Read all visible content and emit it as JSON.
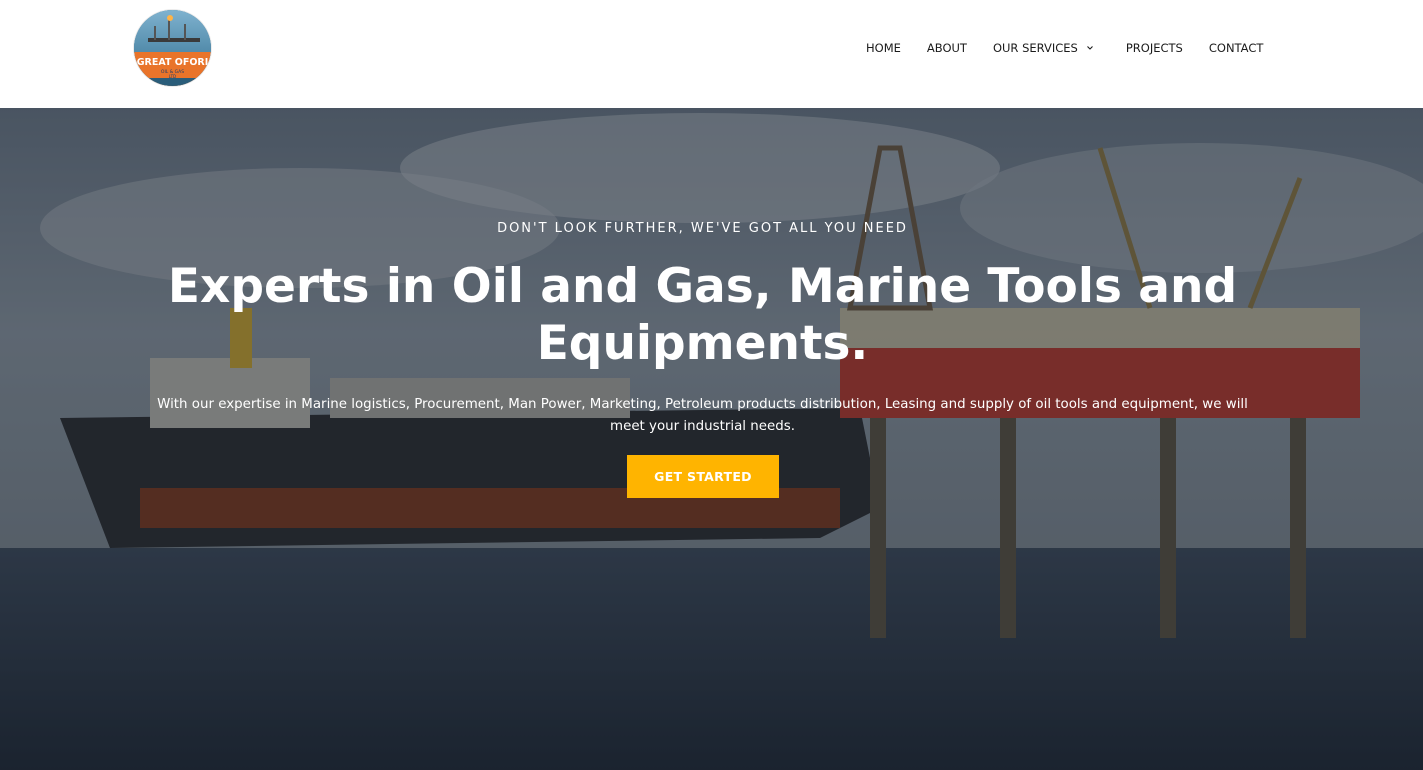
{
  "brand": {
    "logo_lines": [
      "GREAT OFORI",
      "OIL & GAS",
      "LTD"
    ]
  },
  "nav": {
    "items": [
      {
        "label": "HOME"
      },
      {
        "label": "ABOUT"
      },
      {
        "label": "OUR SERVICES",
        "has_dropdown": true
      },
      {
        "label": "PROJECTS"
      },
      {
        "label": "CONTACT"
      }
    ]
  },
  "hero": {
    "eyebrow": "DON'T LOOK FURTHER, WE'VE GOT ALL YOU NEED",
    "headline": "Experts in Oil and Gas, Marine Tools and Equipments.",
    "lead": "With our expertise in Marine logistics, Procurement, Man Power, Marketing, Petroleum products distribution, Leasing and supply of oil tools and equipment, we will meet your industrial needs.",
    "cta_label": "GET STARTED"
  },
  "colors": {
    "accent": "#ffb400",
    "nav_text": "#1b1b1b",
    "hero_text": "#ffffff"
  }
}
